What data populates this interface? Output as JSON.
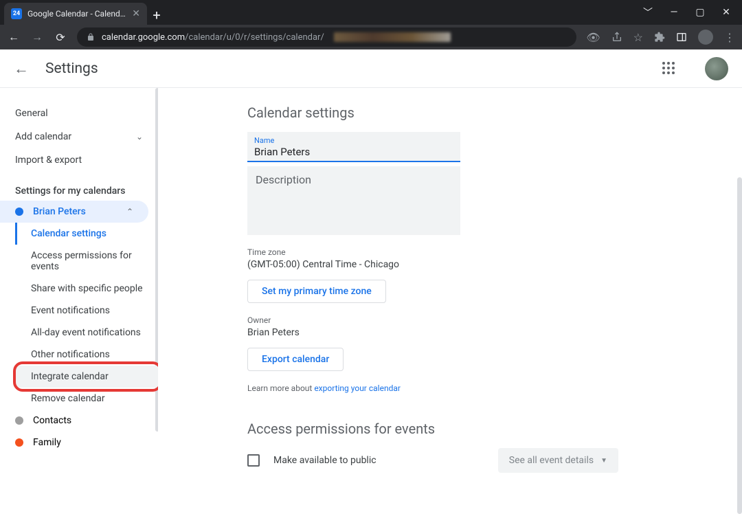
{
  "browser": {
    "tab_title": "Google Calendar - Calendar setti",
    "url_prefix": "calendar.google.com",
    "url_path": "/calendar/u/0/r/settings/calendar/"
  },
  "header": {
    "title": "Settings"
  },
  "sidebar": {
    "general": "General",
    "add_calendar": "Add calendar",
    "import_export": "Import & export",
    "section_heading": "Settings for my calendars",
    "calendars": [
      {
        "label": "Brian Peters",
        "color": "#1a73e8",
        "expanded": true,
        "active": true
      },
      {
        "label": "Contacts",
        "color": "#9e9e9e"
      },
      {
        "label": "Family",
        "color": "#f4511e"
      }
    ],
    "sub_items": [
      {
        "label": "Calendar settings",
        "active": true
      },
      {
        "label": "Access permissions for events"
      },
      {
        "label": "Share with specific people"
      },
      {
        "label": "Event notifications"
      },
      {
        "label": "All-day event notifications"
      },
      {
        "label": "Other notifications"
      },
      {
        "label": "Integrate calendar",
        "highlighted": true
      },
      {
        "label": "Remove calendar"
      }
    ]
  },
  "main": {
    "section1_title": "Calendar settings",
    "name_label": "Name",
    "name_value": "Brian Peters",
    "description_label": "Description",
    "timezone_label": "Time zone",
    "timezone_value": "(GMT-05:00) Central Time - Chicago",
    "set_tz_button": "Set my primary time zone",
    "owner_label": "Owner",
    "owner_value": "Brian Peters",
    "export_button": "Export calendar",
    "learn_more_prefix": "Learn more about ",
    "learn_more_link": "exporting your calendar",
    "section2_title": "Access permissions for events",
    "public_checkbox_label": "Make available to public",
    "details_dropdown": "See all event details"
  }
}
